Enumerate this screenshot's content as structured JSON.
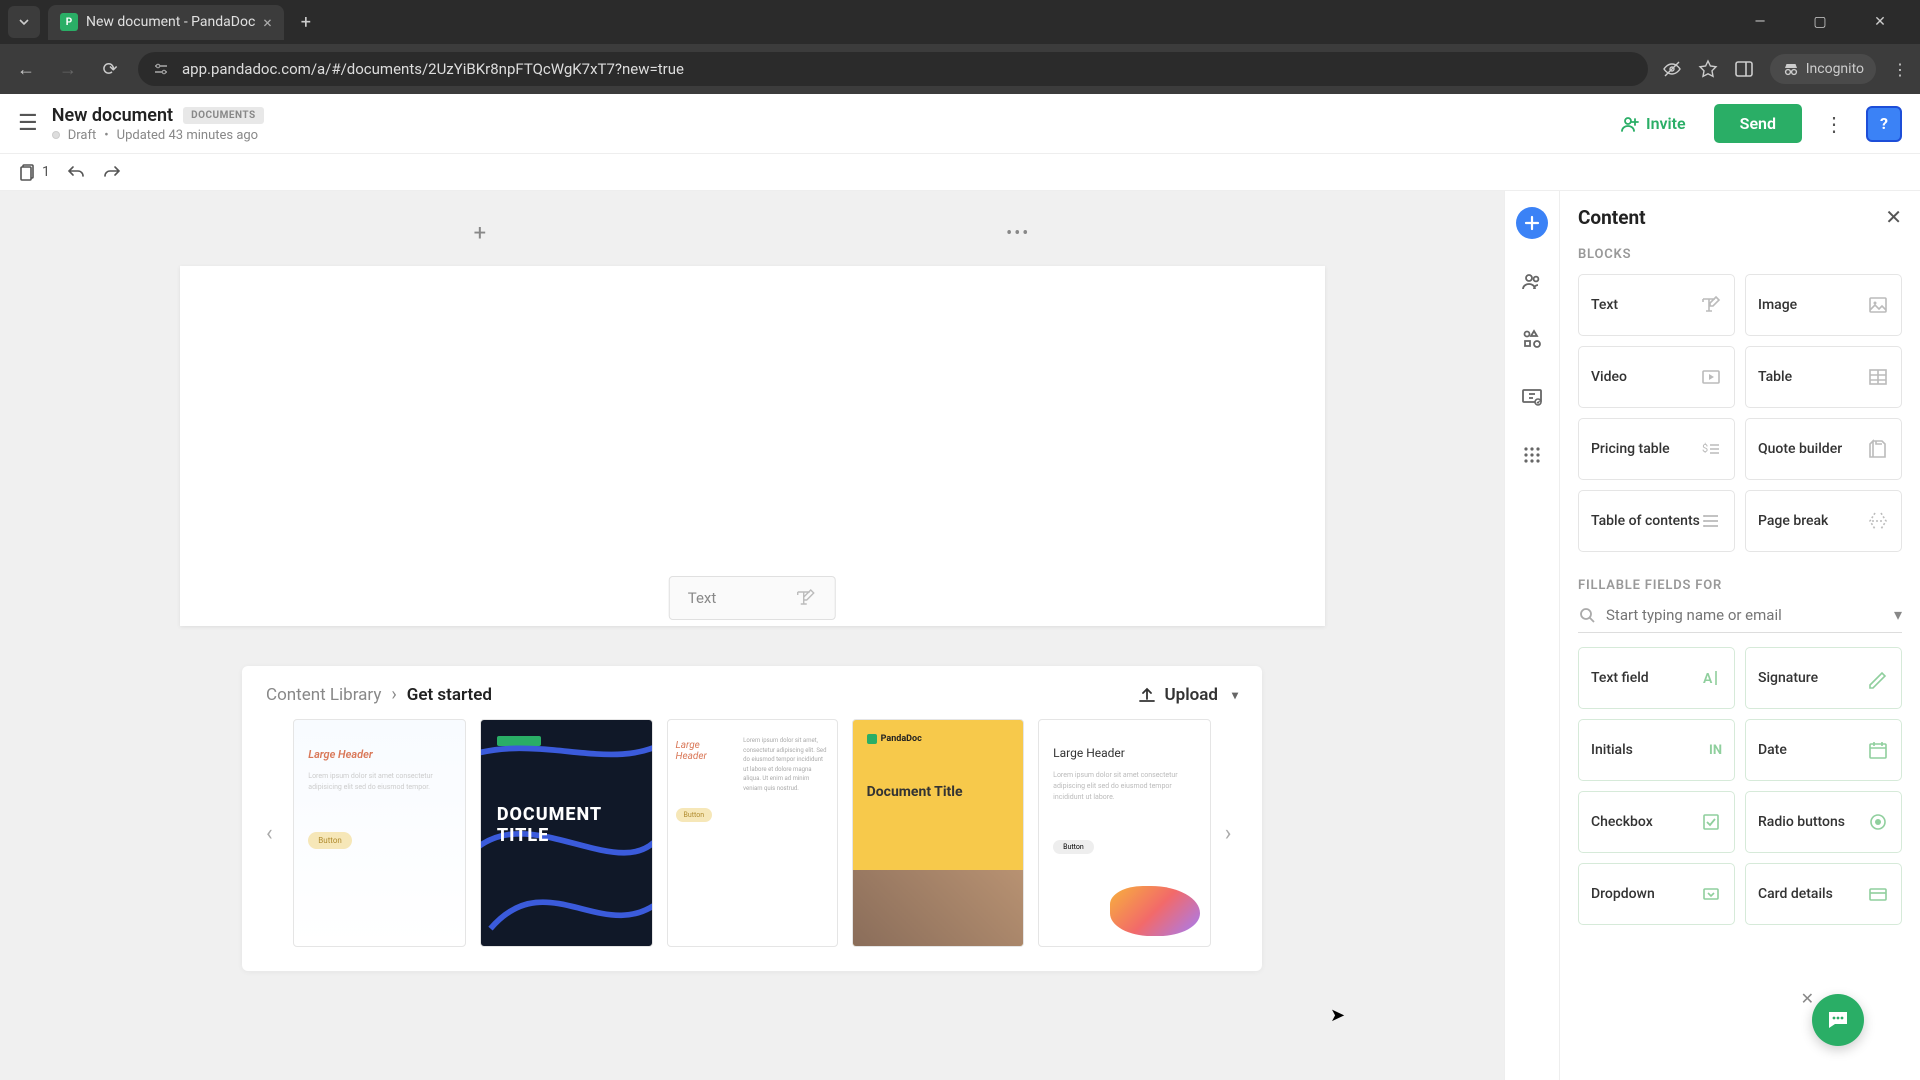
{
  "browser": {
    "tab_title": "New document - PandaDoc",
    "url": "app.pandadoc.com/a/#/documents/2UzYiBKr8npFTQcWgK7xT7?new=true",
    "incognito_label": "Incognito"
  },
  "header": {
    "doc_title": "New document",
    "badge": "DOCUMENTS",
    "status": "Draft",
    "updated": "Updated 43 minutes ago",
    "invite_label": "Invite",
    "send_label": "Send",
    "help_label": "?"
  },
  "toolbar": {
    "page_count": "1"
  },
  "canvas": {
    "text_placeholder": "Text"
  },
  "library": {
    "breadcrumb_root": "Content Library",
    "breadcrumb_current": "Get started",
    "upload_label": "Upload",
    "templates": {
      "t1_header": "Large Header",
      "t2_title": "DOCUMENT TITLE",
      "t3_header": "Large Header",
      "t4_brand": "PandaDoc",
      "t4_title": "Document Title",
      "t5_header": "Large Header"
    }
  },
  "panel": {
    "title": "Content",
    "section_blocks": "BLOCKS",
    "section_fields": "FILLABLE FIELDS FOR",
    "search_placeholder": "Start typing name or email",
    "blocks": {
      "text": "Text",
      "image": "Image",
      "video": "Video",
      "table": "Table",
      "pricing": "Pricing table",
      "quote": "Quote builder",
      "toc": "Table of contents",
      "pagebreak": "Page break"
    },
    "fields": {
      "textfield": "Text field",
      "signature": "Signature",
      "initials": "Initials",
      "initials_icon": "IN",
      "date": "Date",
      "checkbox": "Checkbox",
      "radio": "Radio buttons",
      "dropdown": "Dropdown",
      "card": "Card details"
    }
  }
}
